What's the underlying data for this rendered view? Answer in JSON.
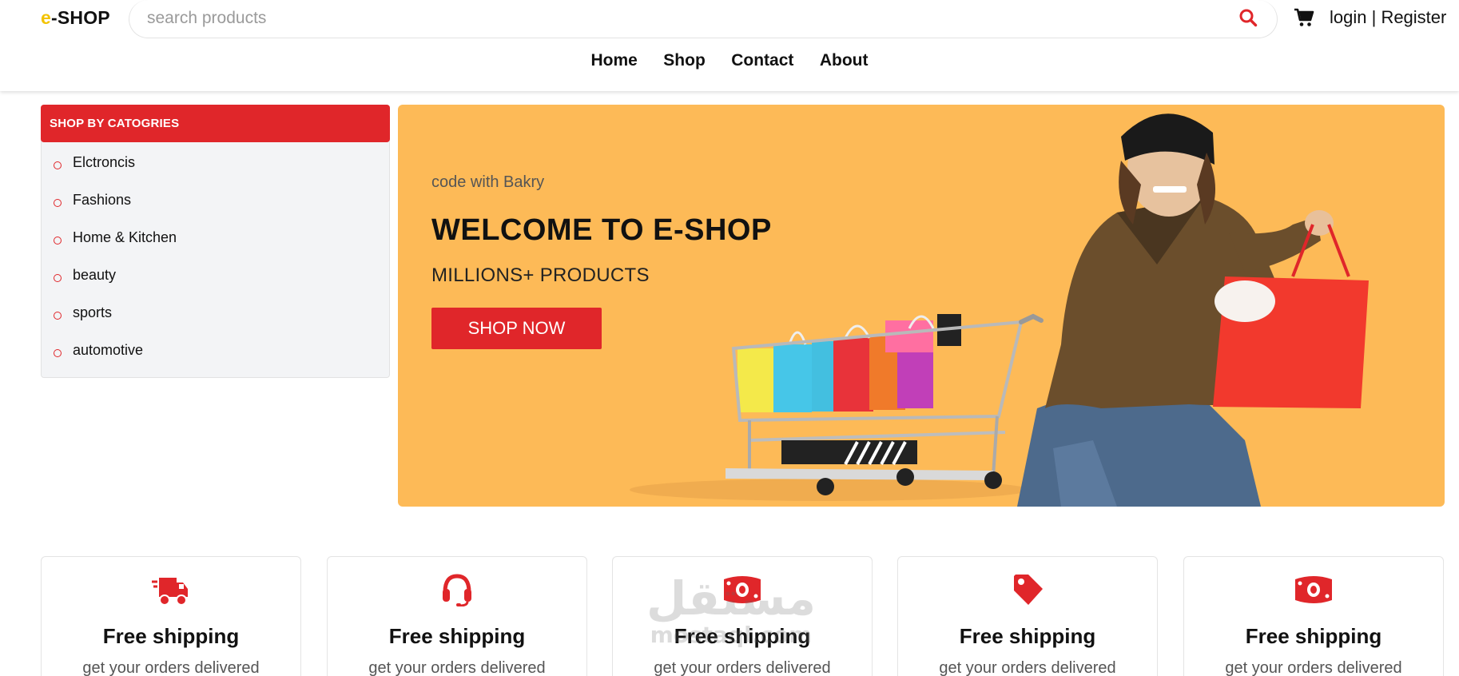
{
  "header": {
    "logo_prefix": "e",
    "logo_suffix": "-SHOP",
    "search_placeholder": "search products",
    "login_label": "login",
    "separator": " | ",
    "register_label": "Register"
  },
  "nav": {
    "items": [
      "Home",
      "Shop",
      "Contact",
      "About"
    ]
  },
  "categories": {
    "heading": "SHOP BY CATOGRIES",
    "items": [
      "Elctroncis",
      "Fashions",
      "Home & Kitchen",
      "beauty",
      "sports",
      "automotive"
    ]
  },
  "hero": {
    "subtitle": "code with Bakry",
    "title": "WELCOME TO E-SHOP",
    "tagline": "MILLIONS+ PRODUCTS",
    "button_label": "SHOP NOW"
  },
  "features": [
    {
      "icon": "truck-icon",
      "title": "Free shipping",
      "desc": "get your orders delivered"
    },
    {
      "icon": "headset-icon",
      "title": "Free shipping",
      "desc": "get your orders delivered"
    },
    {
      "icon": "money-icon",
      "title": "Free shipping",
      "desc": "get your orders delivered"
    },
    {
      "icon": "tag-icon",
      "title": "Free shipping",
      "desc": "get your orders delivered"
    },
    {
      "icon": "money-icon",
      "title": "Free shipping",
      "desc": "get your orders delivered"
    }
  ],
  "watermark": {
    "arabic": "مستقل",
    "latin": "mostaql.com"
  },
  "colors": {
    "accent": "#e0262a",
    "logo_yellow": "#f3c300",
    "hero_bg": "#fdba57",
    "sidebar_bg": "#f3f4f6"
  }
}
